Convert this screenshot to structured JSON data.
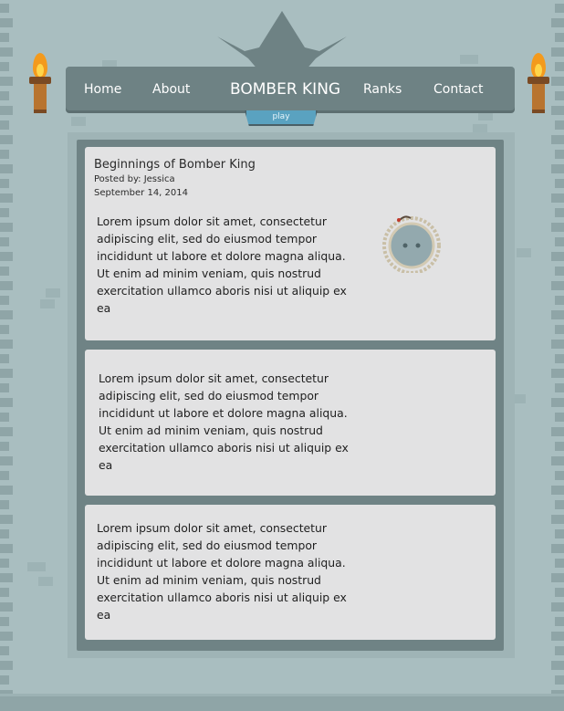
{
  "nav": {
    "home": "Home",
    "about": "About",
    "title": "BOMBER KING",
    "ranks": "Ranks",
    "contact": "Contact",
    "play": "play"
  },
  "posts": [
    {
      "title": "Beginnings of Bomber King",
      "author": "Posted by: Jessica",
      "date": "September 14, 2014",
      "body": "Lorem ipsum dolor sit amet, consectetur adipiscing elit, sed do eiusmod tempor incididunt ut labore et dolore magna aliqua. Ut enim ad minim veniam, quis nostrud exercitation ullamco aboris nisi ut aliquip ex ea"
    },
    {
      "body": "Lorem ipsum dolor sit amet, consectetur adipiscing elit, sed do eiusmod tempor incididunt ut labore et dolore magna aliqua. Ut enim ad minim veniam, quis nostrud exercitation ullamco aboris nisi ut aliquip ex ea"
    },
    {
      "body": "Lorem ipsum dolor sit amet, consectetur adipiscing elit, sed do eiusmod tempor incididunt ut labore et dolore magna aliqua. Ut enim ad minim veniam, quis nostrud exercitation ullamco aboris nisi ut aliquip ex ea"
    }
  ],
  "icons": {
    "crown": "crown-icon",
    "bomb": "bomb-icon",
    "torch": "torch-icon"
  },
  "colors": {
    "background": "#a9bec0",
    "navbar": "#6e8284",
    "card": "#e2e2e3",
    "play_button": "#5aa2c0",
    "flame": "#f39a1d"
  }
}
